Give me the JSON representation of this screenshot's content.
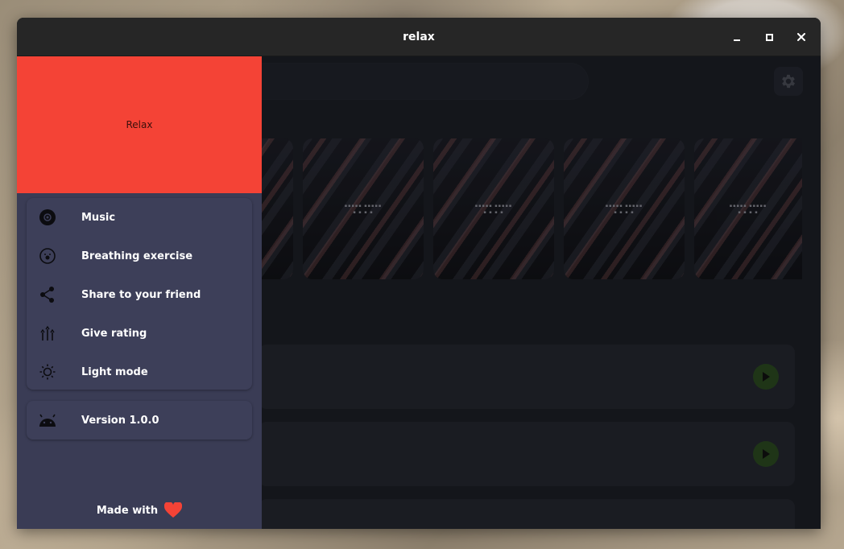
{
  "window": {
    "title": "relax",
    "controls": {
      "minimize_icon": "minimize-icon",
      "maximize_icon": "maximize-icon",
      "close_icon": "close-icon"
    }
  },
  "colors": {
    "drawer_header": "#f44336",
    "drawer_background": "#3a3c55",
    "content_background": "#1d1f26",
    "titlebar": "#262626",
    "play_button": "#2b4a21",
    "heart": "#f44336"
  },
  "drawer": {
    "header_title": "Relax",
    "items": [
      {
        "label": "Music",
        "icon": "disc-icon"
      },
      {
        "label": "Breathing exercise",
        "icon": "breathing-icon"
      },
      {
        "label": "Share to your friend",
        "icon": "share-icon"
      },
      {
        "label": "Give rating",
        "icon": "rating-icon"
      },
      {
        "label": "Light mode",
        "icon": "sun-icon"
      }
    ],
    "version": {
      "label": "Version 1.0.0",
      "icon": "android-icon"
    },
    "footer": {
      "text": "Made with",
      "icon": "heart-icon"
    }
  },
  "main": {
    "settings_icon": "gear-icon",
    "album_count": 5,
    "track_count": 3,
    "play_icon": "play-icon"
  }
}
